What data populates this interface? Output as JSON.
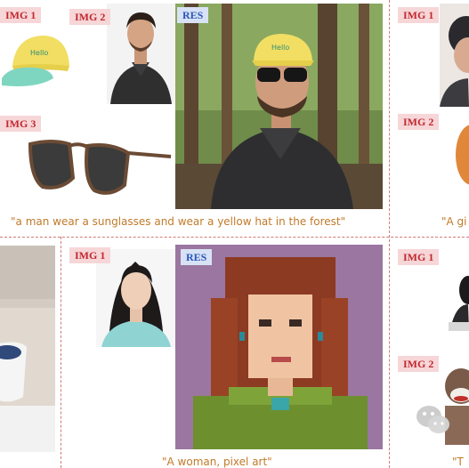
{
  "panels": {
    "top_left": {
      "tags": [
        "IMG 1",
        "IMG 2",
        "IMG 3",
        "RES"
      ],
      "caption": "\"a man wear a sunglasses and wear a yellow hat in the forest\"",
      "hat_text": "Hello"
    },
    "top_right": {
      "tags": [
        "IMG 1",
        "IMG 2"
      ],
      "caption": "\"A gi"
    },
    "bottom_middle": {
      "tags": [
        "IMG 1",
        "RES"
      ],
      "caption": "\"A woman, pixel art\""
    },
    "bottom_right": {
      "tags": [
        "IMG 1",
        "IMG 2"
      ],
      "caption": "\"T"
    }
  },
  "colors": {
    "tag_bg": "#f7d6d8",
    "tag_text": "#c0282e",
    "res_bg": "#d8e2f5",
    "res_text": "#2a56b8",
    "caption": "#c07a2a",
    "divider": "#d27a7a"
  },
  "icons": [
    "wechat-icon"
  ]
}
